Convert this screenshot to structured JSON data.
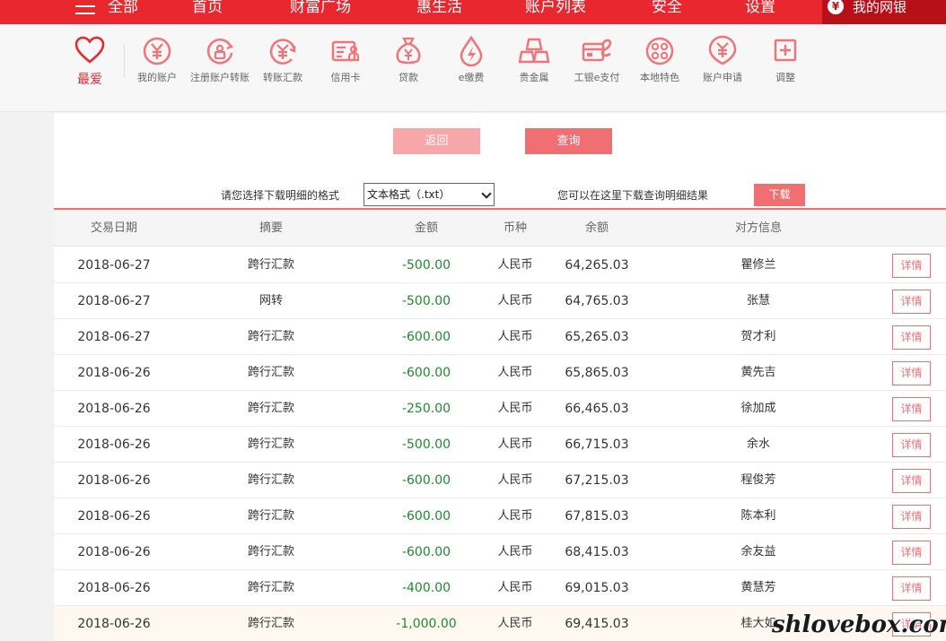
{
  "nav": {
    "all": "全部",
    "items": [
      "首页",
      "财富广场",
      "惠生活",
      "账户列表",
      "安全",
      "设置"
    ],
    "mybank": "我的网银",
    "mybank_icon": "yen-coin-icon"
  },
  "iconbar": {
    "favorite": "最爱",
    "tools": [
      {
        "label": "我的账户",
        "icon": "yen-circle-icon"
      },
      {
        "label": "注册账户转账",
        "icon": "register-transfer-icon"
      },
      {
        "label": "转账汇款",
        "icon": "transfer-icon"
      },
      {
        "label": "信用卡",
        "icon": "credit-card-icon"
      },
      {
        "label": "贷款",
        "icon": "money-bag-icon"
      },
      {
        "label": "e缴费",
        "icon": "payment-drop-icon"
      },
      {
        "label": "贵金属",
        "icon": "gold-bars-icon"
      },
      {
        "label": "工银e支付",
        "icon": "epay-card-icon"
      },
      {
        "label": "本地特色",
        "icon": "local-feature-icon"
      },
      {
        "label": "账户申请",
        "icon": "account-apply-icon"
      },
      {
        "label": "调整",
        "icon": "plus-box-icon"
      }
    ]
  },
  "actions": {
    "back": "返回",
    "query": "查询"
  },
  "download": {
    "label": "请您选择下载明细的格式",
    "format_selected": "文本格式（.txt）",
    "hint": "您可以在这里下载查询明细结果",
    "button": "下载"
  },
  "table": {
    "headers": [
      "交易日期",
      "摘要",
      "金额",
      "币种",
      "余额",
      "对方信息"
    ],
    "detail_label": "详情",
    "rows": [
      {
        "date": "2018-06-27",
        "summary": "跨行汇款",
        "amount": "-500.00",
        "currency": "人民币",
        "balance": "64,265.03",
        "party": "瞿修兰"
      },
      {
        "date": "2018-06-27",
        "summary": "网转",
        "amount": "-500.00",
        "currency": "人民币",
        "balance": "64,765.03",
        "party": "张慧"
      },
      {
        "date": "2018-06-27",
        "summary": "跨行汇款",
        "amount": "-600.00",
        "currency": "人民币",
        "balance": "65,265.03",
        "party": "贺才利"
      },
      {
        "date": "2018-06-26",
        "summary": "跨行汇款",
        "amount": "-600.00",
        "currency": "人民币",
        "balance": "65,865.03",
        "party": "黄先吉"
      },
      {
        "date": "2018-06-26",
        "summary": "跨行汇款",
        "amount": "-250.00",
        "currency": "人民币",
        "balance": "66,465.03",
        "party": "徐加成"
      },
      {
        "date": "2018-06-26",
        "summary": "跨行汇款",
        "amount": "-500.00",
        "currency": "人民币",
        "balance": "66,715.03",
        "party": "余水"
      },
      {
        "date": "2018-06-26",
        "summary": "跨行汇款",
        "amount": "-600.00",
        "currency": "人民币",
        "balance": "67,215.03",
        "party": "程俊芳"
      },
      {
        "date": "2018-06-26",
        "summary": "跨行汇款",
        "amount": "-600.00",
        "currency": "人民币",
        "balance": "67,815.03",
        "party": "陈本利"
      },
      {
        "date": "2018-06-26",
        "summary": "跨行汇款",
        "amount": "-600.00",
        "currency": "人民币",
        "balance": "68,415.03",
        "party": "余友益"
      },
      {
        "date": "2018-06-26",
        "summary": "跨行汇款",
        "amount": "-400.00",
        "currency": "人民币",
        "balance": "69,015.03",
        "party": "黄慧芳"
      },
      {
        "date": "2018-06-26",
        "summary": "跨行汇款",
        "amount": "-1,000.00",
        "currency": "人民币",
        "balance": "69,415.03",
        "party": "桂大如"
      }
    ]
  },
  "watermark": "shlovebox.com",
  "colors": {
    "brand_red": "#e8272f",
    "button_red": "#f06f73",
    "button_disabled": "#f7a6a9",
    "amount_green": "#1e8a2e"
  }
}
